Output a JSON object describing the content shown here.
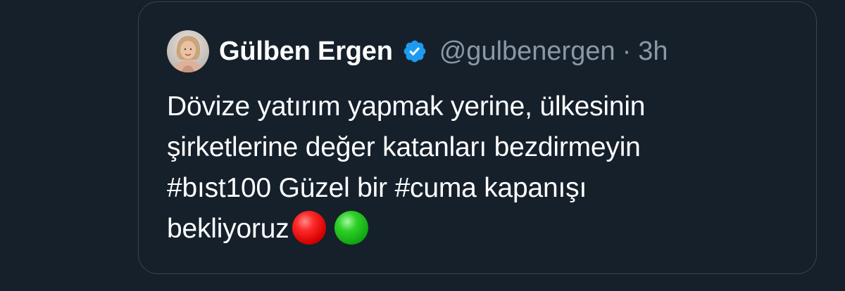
{
  "tweet": {
    "author": {
      "display_name": "Gülben Ergen",
      "verified": true,
      "handle": "@gulbenergen",
      "separator": "·",
      "time": "3h"
    },
    "text": {
      "line1": "Dövize yatırım yapmak yerine, ülkesinin",
      "line2": "şirketlerine değer katanları bezdirmeyin",
      "line3_hashtag1": "#bıst100",
      "line3_mid": " Güzel bir ",
      "line3_hashtag2": "#cuma",
      "line3_end": " kapanışı",
      "line4": "bekliyoruz",
      "emojis": [
        "red-circle-emoji",
        "green-circle-emoji"
      ]
    }
  },
  "colors": {
    "background": "#15202b",
    "border": "#38444d",
    "secondary_text": "#8b98a5",
    "verified_badge": "#1d9bf0"
  }
}
